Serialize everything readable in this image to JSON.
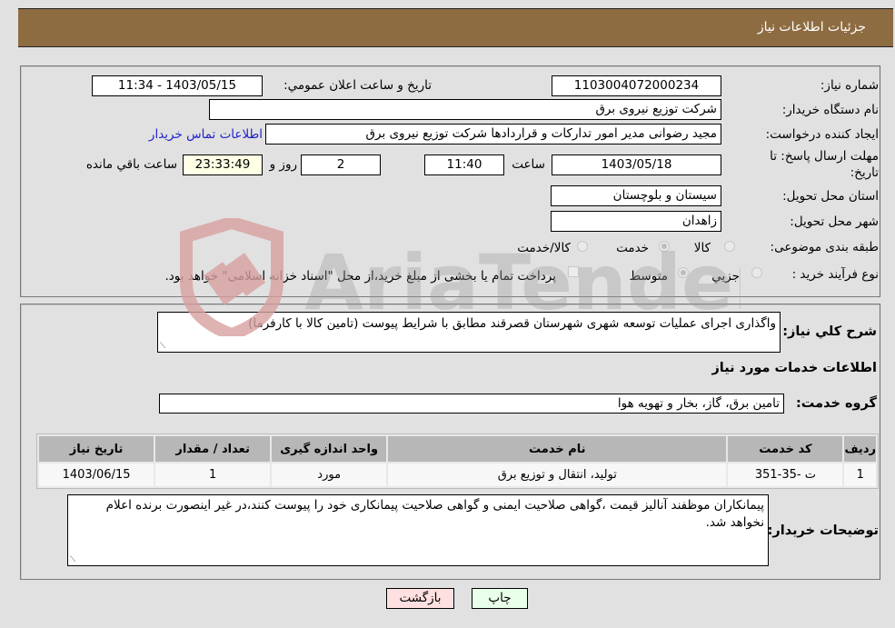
{
  "header": {
    "title": "جزئیات اطلاعات نیاز"
  },
  "form": {
    "need_number_label": "شماره نیاز:",
    "need_number": "1103004072000234",
    "announce_label": "تاریخ و ساعت اعلان عمومي:",
    "announce_value": "1403/05/15 - 11:34",
    "buyer_org_label": "نام دستگاه خريدار:",
    "buyer_org": "شرکت توزیع نیروی برق",
    "creator_label": "ایجاد کننده درخواست:",
    "creator": "مجید  رضوانی مدیر امور تدارکات و قراردادها شرکت توزیع نیروی برق",
    "contact_link": "اطلاعات تماس خريدار",
    "deadline_label": "مهلت ارسال پاسخ: تا تاریخ:",
    "deadline_date": "1403/05/18",
    "time_label": "ساعت",
    "deadline_time": "11:40",
    "days_value": "2",
    "days_label": "روز و",
    "remaining_time": "23:33:49",
    "remaining_label": "ساعت باقي مانده",
    "province_label": "استان محل تحویل:",
    "province": "سیستان و بلوچستان",
    "city_label": "شهر محل تحویل:",
    "city": "زاهدان",
    "category_label": "طبقه بندی موضوعی:",
    "category_options": [
      {
        "label": "کالا",
        "checked": false
      },
      {
        "label": "خدمت",
        "checked": true
      },
      {
        "label": "کالا/خدمت",
        "checked": false
      }
    ],
    "process_label": "نوع فرآیند خرید :",
    "process_options": [
      {
        "label": "جزيي",
        "checked": false
      },
      {
        "label": "متوسط",
        "checked": true
      }
    ],
    "treasury_checkbox_label": "پرداخت تمام یا بخشی از مبلغ خرید،از محل \"اسناد خزانه اسلامی\" خواهد بود.",
    "treasury_checked": false
  },
  "details": {
    "description_label": "شرح کلي نياز:",
    "description": "واگذاری اجرای عملیات توسعه شهری شهرستان قصرقند مطابق با شرایط پیوست (تامین کالا با کارفرما)",
    "services_heading": "اطلاعات خدمات مورد نياز",
    "service_group_label": "گروه خدمت:",
    "service_group": "تامین برق، گاز، بخار و تهویه هوا",
    "table": {
      "headers": [
        "ردیف",
        "کد خدمت",
        "نام خدمت",
        "واحد اندازه گیری",
        "تعداد / مقدار",
        "تاریخ نیاز"
      ],
      "rows": [
        [
          "1",
          "ت -35-351",
          "تولید، انتقال و توزیع برق",
          "مورد",
          "1",
          "1403/06/15"
        ]
      ]
    },
    "buyer_notes_label": "توضیحات خریدار:",
    "buyer_notes": "پیمانکاران موظفند آنالیز قیمت ،گواهی صلاحیت ایمنی و گواهی صلاحیت پیمانکاری خود را پیوست کنند،در غیر اینصورت برنده اعلام نخواهد شد."
  },
  "buttons": {
    "print": "چاپ",
    "back": "بازگشت"
  },
  "colors": {
    "header_bg": "#8e6c42",
    "print_bg": "#eaffea",
    "back_bg": "#ffe0e0",
    "link": "#2222cc"
  },
  "watermark": {
    "text": "AriaTender.neT"
  }
}
